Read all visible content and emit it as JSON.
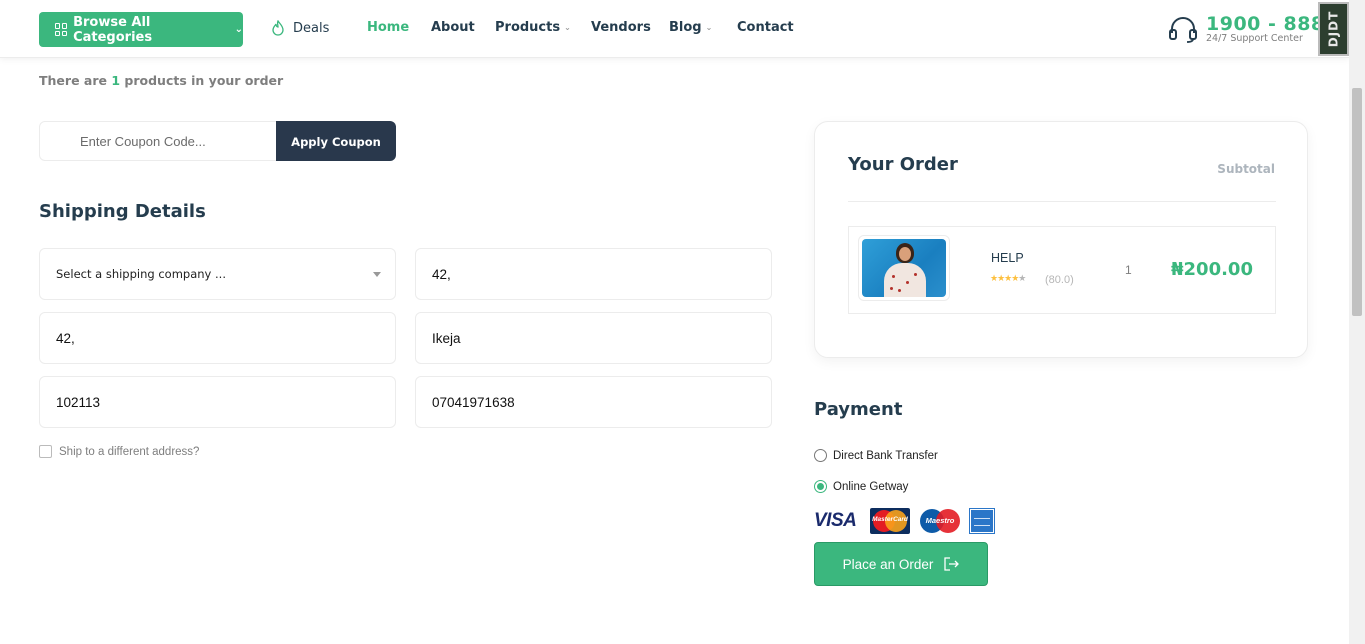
{
  "header": {
    "browse_label": "Browse All Categories",
    "nav": [
      {
        "label": "Deals",
        "active": false
      },
      {
        "label": "Home",
        "active": true
      },
      {
        "label": "About",
        "active": false
      },
      {
        "label": "Products",
        "active": false
      },
      {
        "label": "Vendors",
        "active": false
      },
      {
        "label": "Blog",
        "active": false
      },
      {
        "label": "Contact",
        "active": false
      }
    ],
    "support_number": "1900 - 888",
    "support_label": "24/7 Support Center",
    "debug_toolbar": "DJDT"
  },
  "order_summary": {
    "prefix": "There are",
    "count": "1",
    "suffix": "products in your order"
  },
  "coupon": {
    "placeholder": "Enter Coupon Code...",
    "button_label": "Apply Coupon"
  },
  "shipping": {
    "title": "Shipping Details",
    "company_select": "Select a shipping company ...",
    "address_line_1": "42,",
    "address_line_2": "42,",
    "city": "Ikeja",
    "postcode": "102113",
    "phone": "07041971638",
    "different_address_label": "Ship to a different address?"
  },
  "your_order": {
    "title": "Your Order",
    "subtotal_label": "Subtotal",
    "items": [
      {
        "name": "HELP",
        "rating": "(80.0)",
        "stars": 4,
        "quantity": "1",
        "price": "₦200.00"
      }
    ]
  },
  "payment": {
    "title": "Payment",
    "options": [
      {
        "label": "Direct Bank Transfer",
        "selected": false
      },
      {
        "label": "Online Getway",
        "selected": true
      }
    ],
    "card_logos": [
      "VISA",
      "MasterCard",
      "Maestro",
      "American Express"
    ],
    "place_order_label": "Place an Order"
  },
  "colors": {
    "brand_green": "#3bb77e",
    "dark_navy": "#29384c",
    "heading": "#253d4e"
  }
}
